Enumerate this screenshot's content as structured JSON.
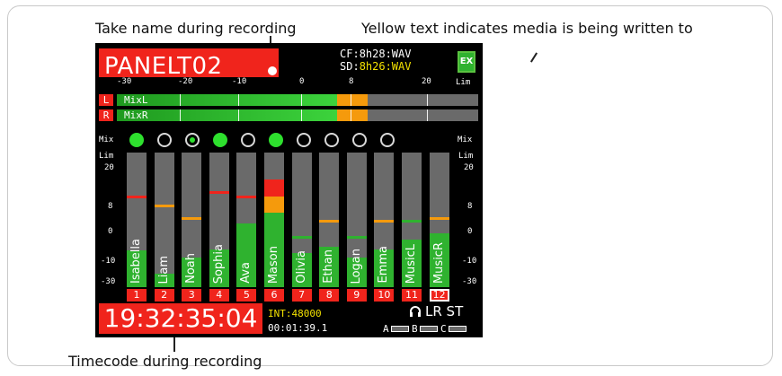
{
  "callouts": {
    "take_name": "Take name during recording",
    "yellow_text": "Yellow text indicates media is being written to",
    "timecode": "Timecode during recording"
  },
  "screen": {
    "take_name": "PANELT02",
    "cf_label": "CF:",
    "cf_value": "8h28:WAV",
    "sd_label": "SD:",
    "sd_value": "8h26:WAV",
    "ex_badge": "EX",
    "lim_label": "Lim",
    "mix_label": "Mix",
    "db_scale_top": [
      "-30",
      "-20",
      "-10",
      "0",
      "8",
      "20"
    ],
    "db_scale_side": [
      "20",
      "8",
      "0",
      "-10",
      "-30"
    ],
    "master": [
      {
        "side": "L",
        "name": "MixL",
        "level": 0.52,
        "peak": 0.56
      },
      {
        "side": "R",
        "name": "MixR",
        "level": 0.52,
        "peak": 0.56
      }
    ],
    "mix_states": [
      "on",
      "off",
      "half",
      "on",
      "off",
      "on",
      "off",
      "off",
      "off",
      "off"
    ],
    "channels": [
      {
        "num": "1",
        "name": "Isabella",
        "level": 0.27,
        "peak": 0.68,
        "peak_color": "#f0241c"
      },
      {
        "num": "2",
        "name": "Liam",
        "level": 0.1,
        "peak": 0.61,
        "peak_color": "#f59a0c"
      },
      {
        "num": "3",
        "name": "Noah",
        "level": 0.22,
        "peak": 0.52,
        "peak_color": "#f59a0c"
      },
      {
        "num": "4",
        "name": "Sophia",
        "level": 0.28,
        "peak": 0.71,
        "peak_color": "#f0241c"
      },
      {
        "num": "5",
        "name": "Ava",
        "level": 0.47,
        "peak": 0.68,
        "peak_color": "#f0241c"
      },
      {
        "num": "6",
        "name": "Mason",
        "level": 0.55,
        "peak": 0.8,
        "peak_color": "#f0241c"
      },
      {
        "num": "7",
        "name": "Olivia",
        "level": 0.25,
        "peak": 0.38,
        "peak_color": "#2fb22f"
      },
      {
        "num": "8",
        "name": "Ethan",
        "level": 0.3,
        "peak": 0.5,
        "peak_color": "#f59a0c"
      },
      {
        "num": "9",
        "name": "Logan",
        "level": 0.22,
        "peak": 0.38,
        "peak_color": "#2fb22f"
      },
      {
        "num": "10",
        "name": "Emma",
        "level": 0.28,
        "peak": 0.5,
        "peak_color": "#f59a0c"
      },
      {
        "num": "11",
        "name": "MusicL",
        "level": 0.35,
        "peak": 0.5,
        "peak_color": "#2fb22f"
      },
      {
        "num": "12",
        "name": "MusicR",
        "level": 0.4,
        "peak": 0.52,
        "peak_color": "#f59a0c"
      }
    ],
    "timecode": "19:32:35:04",
    "sample_rate": "INT:48000",
    "duration": "00:01:39.1",
    "output_mode": "LR ST",
    "tracks": [
      "A",
      "B",
      "C"
    ]
  },
  "colors": {
    "red": "#f0241c",
    "yellow": "#f3e100",
    "green": "#2fb22f",
    "orange": "#f59a0c",
    "gray": "#6a6a6a"
  }
}
